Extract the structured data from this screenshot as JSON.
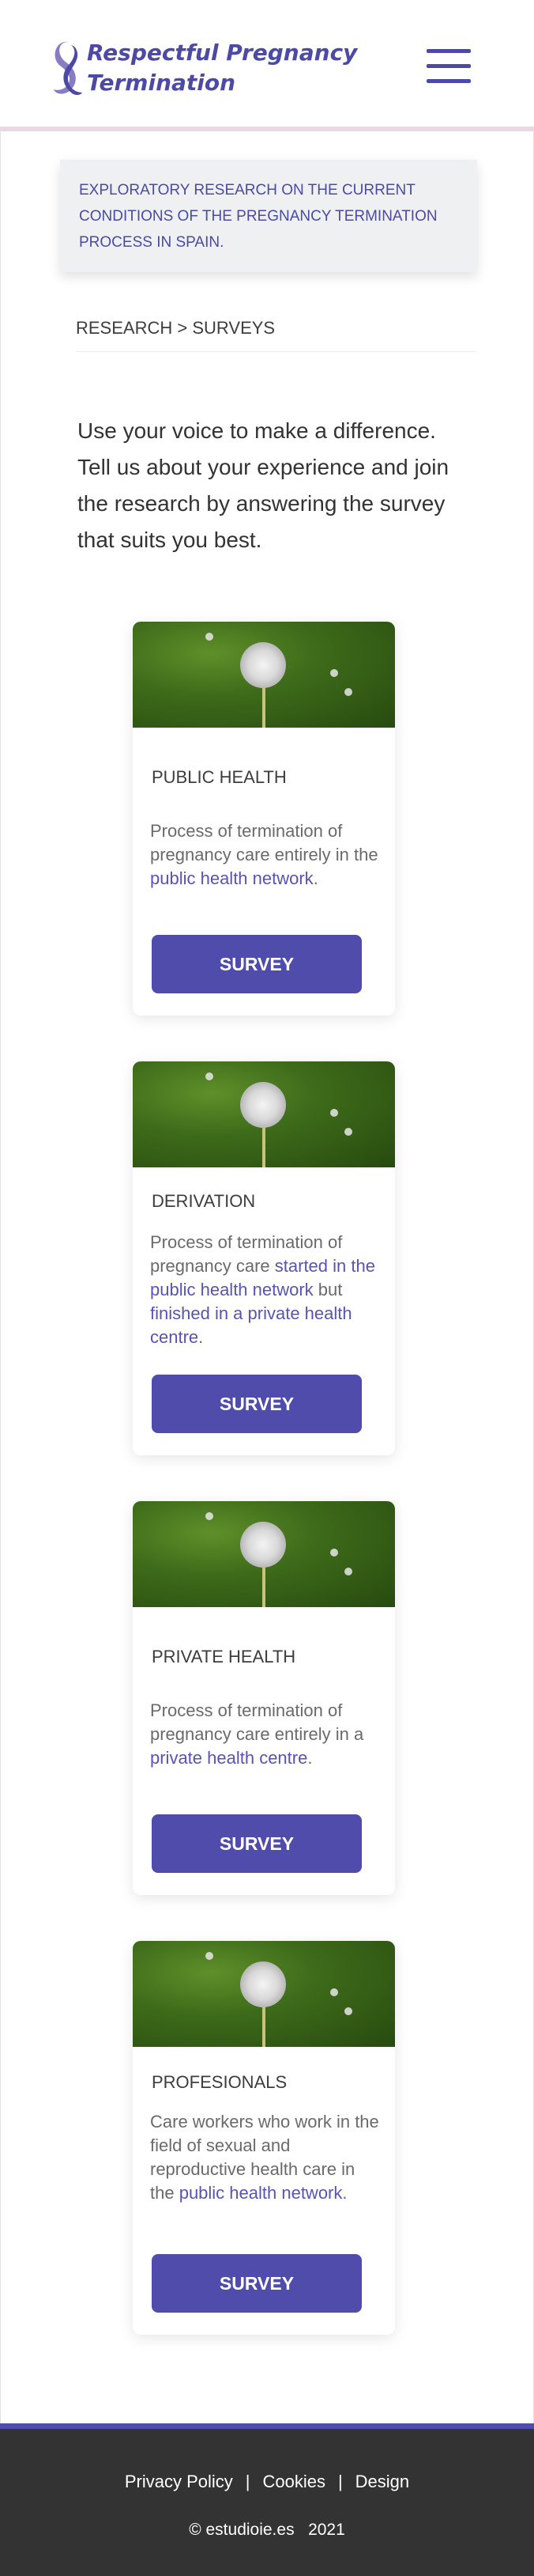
{
  "header": {
    "logo_line1": "Respectful Pregnancy",
    "logo_line2": "Termination",
    "menu_icon": "hamburger-menu-icon"
  },
  "banner": {
    "text": "EXPLORATORY RESEARCH ON THE CURRENT CONDITIONS OF THE PREGNANCY TERMINATION PROCESS IN SPAIN."
  },
  "breadcrumb": {
    "section": "RESEARCH",
    "separator": ">",
    "current": "SURVEYS"
  },
  "intro": "Use your voice to make a difference. Tell us about your experience and join the research by answering the survey that suits you best.",
  "cards": [
    {
      "title": "PUBLIC HEALTH",
      "desc_plain_1": "Process of termination of pregnancy care entirely in the ",
      "desc_hl_1": "public health network",
      "desc_plain_2": ".",
      "button": "SURVEY"
    },
    {
      "title": "DERIVATION",
      "desc_plain_1": "Process of termination of pregnancy care ",
      "desc_hl_1": "started in the public health network",
      "desc_plain_2": " but ",
      "desc_hl_2": "finished in a private health centre",
      "desc_plain_3": ".",
      "button": "SURVEY"
    },
    {
      "title": "PRIVATE HEALTH",
      "desc_plain_1": "Process of termination of pregnancy care entirely in a ",
      "desc_hl_1": "private health centre",
      "desc_plain_2": ".",
      "button": "SURVEY"
    },
    {
      "title": "PROFESIONALS",
      "desc_plain_1": "Care workers who work in the field of sexual and reproductive health care in the ",
      "desc_hl_1": "public health network",
      "desc_plain_2": ".",
      "button": "SURVEY"
    }
  ],
  "footer": {
    "links": [
      "Privacy Policy",
      "Cookies",
      "Design"
    ],
    "separator": "|",
    "copyright": "© estudioie.es   2021"
  },
  "colors": {
    "brand": "#4f4cab",
    "highlight": "#5754b3",
    "footer_bg": "#333333",
    "header_border": "#ead7e3"
  }
}
